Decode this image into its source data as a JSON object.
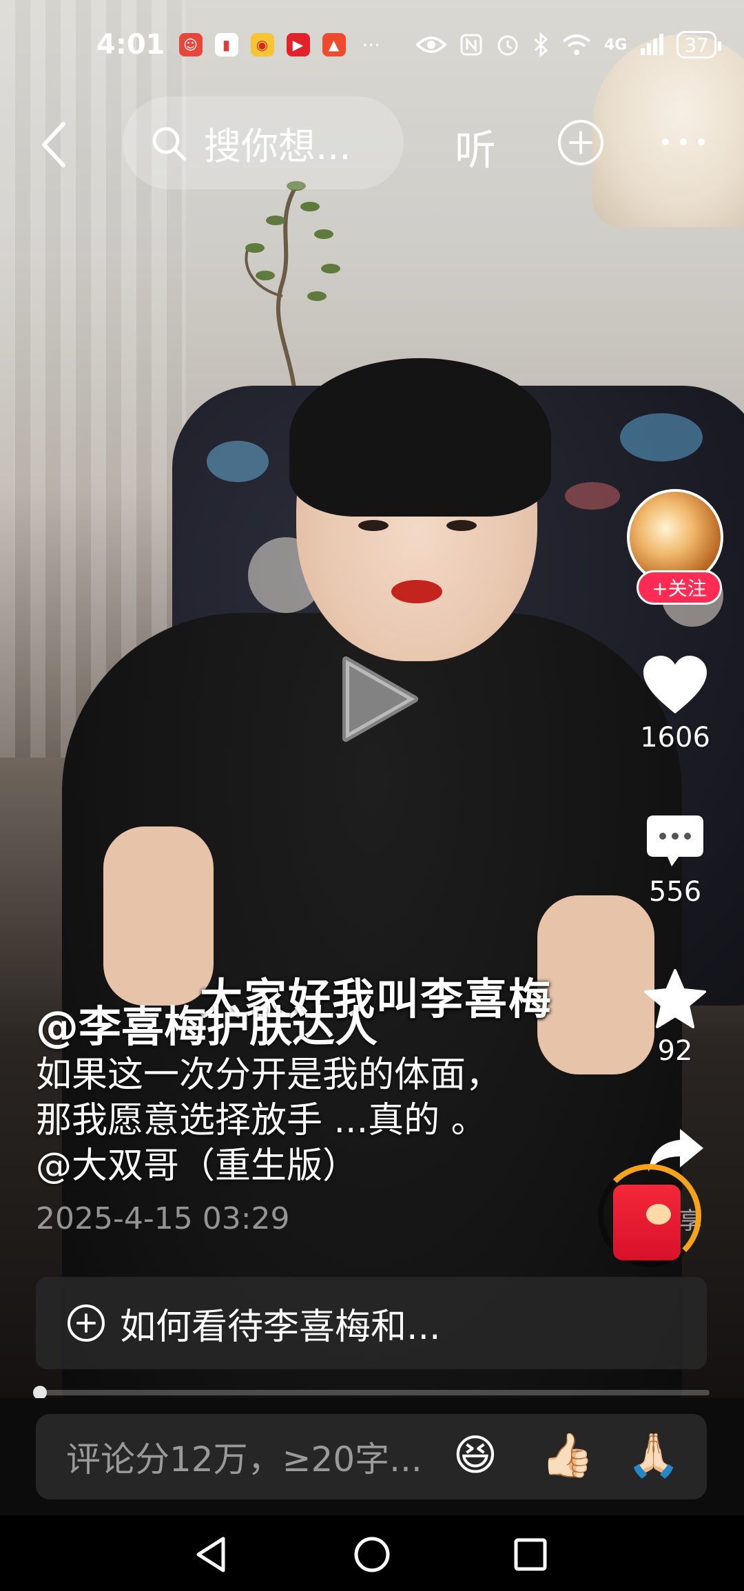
{
  "status_bar": {
    "time": "4:01",
    "notification_icons": [
      "app-notification-icon",
      "red-book-icon",
      "weibo-icon",
      "video-app-icon",
      "alert-app-icon"
    ],
    "more": "···",
    "network": "4G",
    "battery": "37"
  },
  "top_bar": {
    "search_placeholder": "搜你想...",
    "listen_label": "听"
  },
  "video": {
    "subtitle": "大家好我叫李喜梅"
  },
  "author": {
    "name": "@李喜梅护肤达人",
    "follow_label": "+关注"
  },
  "description": {
    "lines": [
      "如果这一次分开是我的体面，",
      "那我愿意选择放手 ...真的 。",
      "@大双哥（重生版）"
    ],
    "date": "2025-4-15 03:29"
  },
  "rail": {
    "likes": "1606",
    "comments": "556",
    "favorites": "92",
    "share_label": "享"
  },
  "topic": {
    "text": "如何看待李喜梅和..."
  },
  "playback": {
    "progress_fraction": 0.0
  },
  "comment_bar": {
    "placeholder": "评论分12万，≥20字...",
    "emojis": [
      "😆",
      "👍🏻",
      "🙏🏻"
    ]
  },
  "colors": {
    "accent": "#fe2c55",
    "progress_ring": "#f7a21b"
  }
}
